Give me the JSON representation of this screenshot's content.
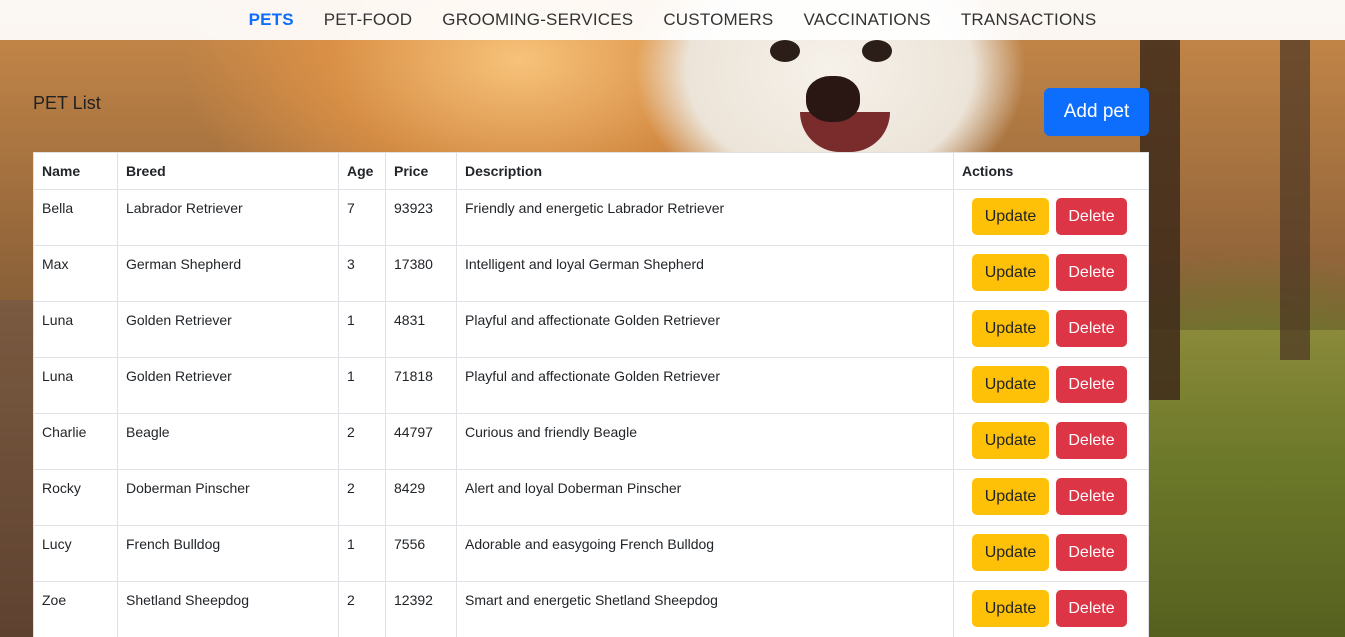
{
  "nav": {
    "items": [
      "PETS",
      "PET-FOOD",
      "GROOMING-SERVICES",
      "CUSTOMERS",
      "VACCINATIONS",
      "TRANSACTIONS"
    ],
    "active": "PETS"
  },
  "page": {
    "title": "PET List",
    "add_label": "Add pet"
  },
  "table": {
    "headers": [
      "Name",
      "Breed",
      "Age",
      "Price",
      "Description",
      "Actions"
    ],
    "update_label": "Update",
    "delete_label": "Delete",
    "rows": [
      {
        "name": "Bella",
        "breed": "Labrador Retriever",
        "age": "7",
        "price": "93923",
        "description": "Friendly and energetic Labrador Retriever"
      },
      {
        "name": "Max",
        "breed": "German Shepherd",
        "age": "3",
        "price": "17380",
        "description": "Intelligent and loyal German Shepherd"
      },
      {
        "name": "Luna",
        "breed": "Golden Retriever",
        "age": "1",
        "price": "4831",
        "description": "Playful and affectionate Golden Retriever"
      },
      {
        "name": "Luna",
        "breed": "Golden Retriever",
        "age": "1",
        "price": "71818",
        "description": "Playful and affectionate Golden Retriever"
      },
      {
        "name": "Charlie",
        "breed": "Beagle",
        "age": "2",
        "price": "44797",
        "description": "Curious and friendly Beagle"
      },
      {
        "name": "Rocky",
        "breed": "Doberman Pinscher",
        "age": "2",
        "price": "8429",
        "description": "Alert and loyal Doberman Pinscher"
      },
      {
        "name": "Lucy",
        "breed": "French Bulldog",
        "age": "1",
        "price": "7556",
        "description": "Adorable and easygoing French Bulldog"
      },
      {
        "name": "Zoe",
        "breed": "Shetland Sheepdog",
        "age": "2",
        "price": "12392",
        "description": "Smart and energetic Shetland Sheepdog"
      }
    ]
  },
  "colors": {
    "accent": "#0d6efd",
    "update": "#ffc107",
    "delete": "#dc3545"
  }
}
